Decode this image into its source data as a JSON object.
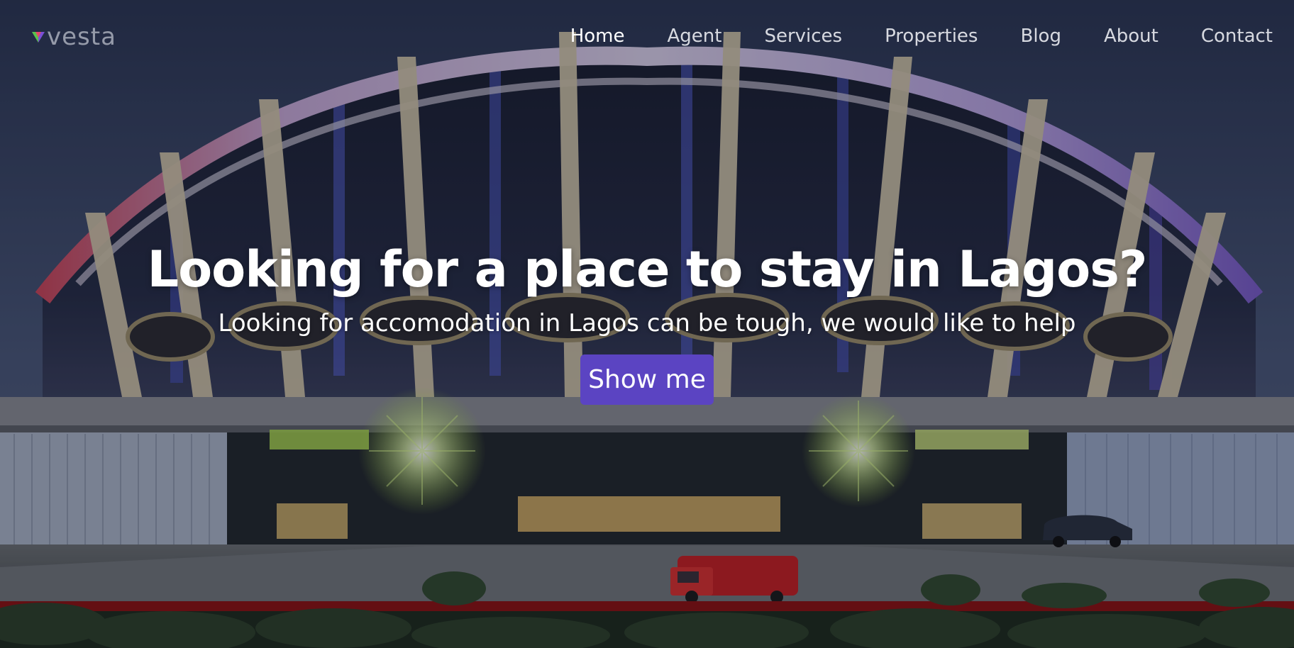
{
  "brand": {
    "logo_text": "vesta",
    "logo_icon": "triangle-mark-icon"
  },
  "nav": {
    "active_color": "#ffffff",
    "items": [
      {
        "label": "Home",
        "active": true
      },
      {
        "label": "Agent"
      },
      {
        "label": "Services"
      },
      {
        "label": "Properties"
      },
      {
        "label": "Blog"
      },
      {
        "label": "About"
      },
      {
        "label": "Contact"
      }
    ]
  },
  "hero": {
    "headline": "Looking for a place to stay in Lagos?",
    "subheadline": "Looking for accomodation in Lagos can be tough, we would like to help",
    "cta_label": "Show me",
    "cta_color": "#5b44c2",
    "background": "National Theatre, Lagos at dusk"
  }
}
